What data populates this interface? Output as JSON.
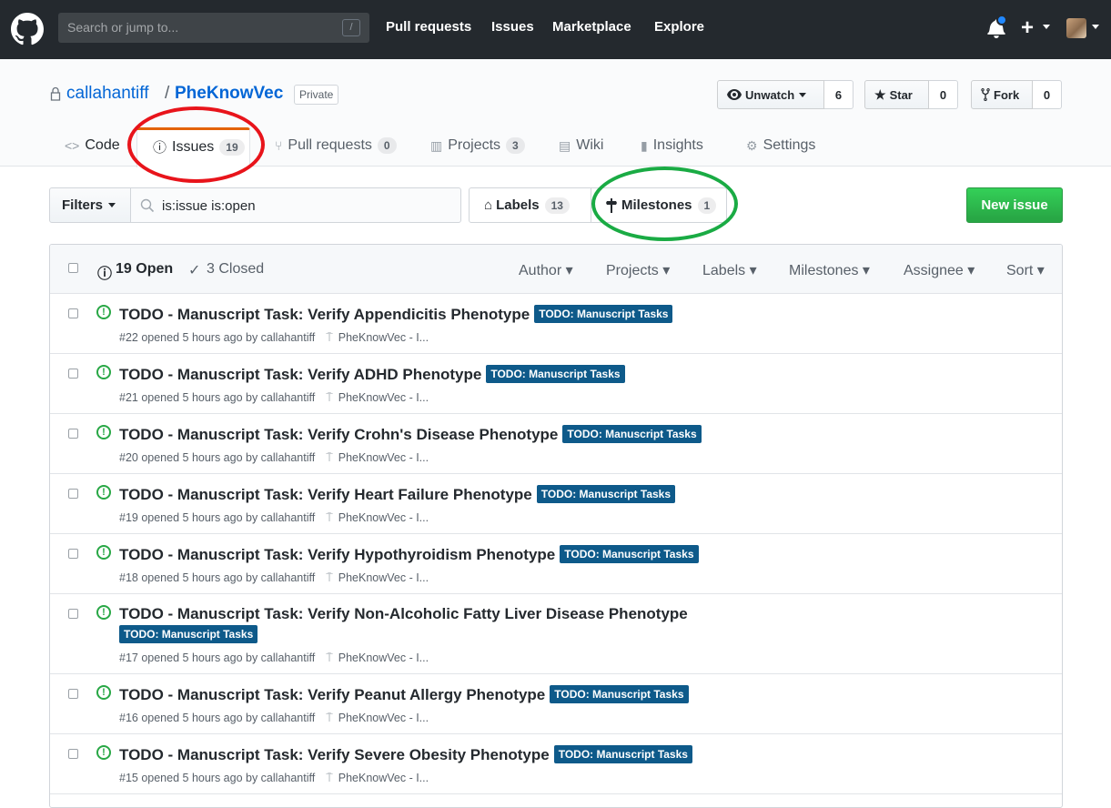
{
  "header": {
    "search_placeholder": "Search or jump to...",
    "search_shortcut": "/",
    "nav": [
      "Pull requests",
      "Issues",
      "Marketplace",
      "Explore"
    ]
  },
  "repo": {
    "owner": "callahantiff",
    "separator": "/",
    "name": "PheKnowVec",
    "visibility": "Private",
    "unwatch_label": "Unwatch",
    "watch_count": "6",
    "star_label": "Star",
    "star_count": "0",
    "fork_label": "Fork",
    "fork_count": "0"
  },
  "tabs": [
    {
      "label": "Code",
      "icon": "code-icon",
      "count": ""
    },
    {
      "label": "Issues",
      "icon": "issue-opened-icon",
      "count": "19"
    },
    {
      "label": "Pull requests",
      "icon": "git-pull-request-icon",
      "count": "0"
    },
    {
      "label": "Projects",
      "icon": "project-icon",
      "count": "3"
    },
    {
      "label": "Wiki",
      "icon": "book-icon",
      "count": ""
    },
    {
      "label": "Insights",
      "icon": "graph-icon",
      "count": ""
    },
    {
      "label": "Settings",
      "icon": "gear-icon",
      "count": ""
    }
  ],
  "toolbar": {
    "filters_label": "Filters",
    "query": "is:issue is:open",
    "labels_label": "Labels",
    "labels_count": "13",
    "milestones_label": "Milestones",
    "milestones_count": "1",
    "new_issue_label": "New issue"
  },
  "list_header": {
    "open": "19 Open",
    "closed": "3 Closed",
    "menus": [
      "Author",
      "Projects",
      "Labels",
      "Milestones",
      "Assignee",
      "Sort"
    ]
  },
  "issues": [
    {
      "title": "TODO - Manuscript Task: Verify Appendicitis Phenotype",
      "label": "TODO: Manuscript Tasks",
      "meta": "#22 opened 5 hours ago by callahantiff",
      "milestone": "PheKnowVec - I..."
    },
    {
      "title": "TODO - Manuscript Task: Verify ADHD Phenotype",
      "label": "TODO: Manuscript Tasks",
      "meta": "#21 opened 5 hours ago by callahantiff",
      "milestone": "PheKnowVec - I..."
    },
    {
      "title": "TODO - Manuscript Task: Verify Crohn's Disease Phenotype",
      "label": "TODO: Manuscript Tasks",
      "meta": "#20 opened 5 hours ago by callahantiff",
      "milestone": "PheKnowVec - I..."
    },
    {
      "title": "TODO - Manuscript Task: Verify Heart Failure Phenotype",
      "label": "TODO: Manuscript Tasks",
      "meta": "#19 opened 5 hours ago by callahantiff",
      "milestone": "PheKnowVec - I..."
    },
    {
      "title": "TODO - Manuscript Task: Verify Hypothyroidism Phenotype",
      "label": "TODO: Manuscript Tasks",
      "meta": "#18 opened 5 hours ago by callahantiff",
      "milestone": "PheKnowVec - I..."
    },
    {
      "title": "TODO - Manuscript Task: Verify Non-Alcoholic Fatty Liver Disease Phenotype",
      "label": "TODO: Manuscript Tasks",
      "meta": "#17 opened 5 hours ago by callahantiff",
      "milestone": "PheKnowVec - I..."
    },
    {
      "title": "TODO - Manuscript Task: Verify Peanut Allergy Phenotype",
      "label": "TODO: Manuscript Tasks",
      "meta": "#16 opened 5 hours ago by callahantiff",
      "milestone": "PheKnowVec - I..."
    },
    {
      "title": "TODO - Manuscript Task: Verify Severe Obesity Phenotype",
      "label": "TODO: Manuscript Tasks",
      "meta": "#15 opened 5 hours ago by callahantiff",
      "milestone": "PheKnowVec - I..."
    }
  ],
  "colors": {
    "header_bg": "#24292e",
    "link": "#0366d6",
    "label_bg": "#0e5a8a",
    "new_issue_bg": "#28a745",
    "annotation_red": "#e8141b",
    "annotation_green": "#1aab44",
    "active_tab_border": "#e36209"
  }
}
